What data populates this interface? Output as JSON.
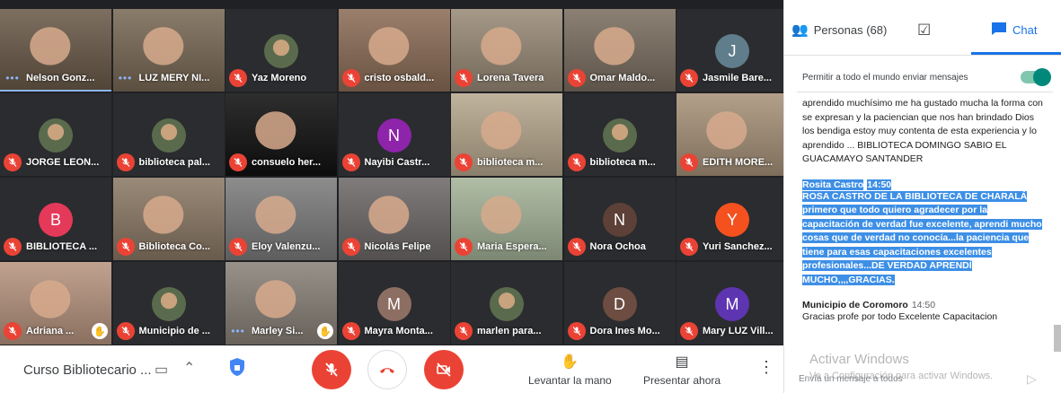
{
  "participants": [
    {
      "name": "Nelson Gonz...",
      "state": "talking",
      "kind": "video",
      "bg": "#6b5b4a"
    },
    {
      "name": "LUZ MERY NI...",
      "state": "talking",
      "kind": "video",
      "bg": "#7a6a56"
    },
    {
      "name": "Yaz Moreno",
      "state": "muted",
      "kind": "photo",
      "bg": "#2b2c2f"
    },
    {
      "name": "cristo osbald...",
      "state": "muted",
      "kind": "video",
      "bg": "#8d6e58"
    },
    {
      "name": "Lorena Tavera",
      "state": "muted",
      "kind": "video",
      "bg": "#9a8b78"
    },
    {
      "name": "Omar Maldo...",
      "state": "muted",
      "kind": "video",
      "bg": "#7c6f61"
    },
    {
      "name": "Jasmile Bare...",
      "state": "muted",
      "kind": "letter",
      "letter": "J",
      "color": "#607d8b",
      "bg": "#2b2c2f"
    },
    {
      "name": "JORGE LEON...",
      "state": "muted",
      "kind": "photo",
      "bg": "#2b2c2f"
    },
    {
      "name": "biblioteca pal...",
      "state": "muted",
      "kind": "photo",
      "bg": "#2b2c2f"
    },
    {
      "name": "consuelo her...",
      "state": "muted",
      "kind": "video",
      "bg": "#111111"
    },
    {
      "name": "Nayibi Castr...",
      "state": "muted",
      "kind": "letter",
      "letter": "N",
      "color": "#8e24aa",
      "bg": "#2b2c2f"
    },
    {
      "name": "biblioteca m...",
      "state": "muted",
      "kind": "video",
      "bg": "#b8a98f"
    },
    {
      "name": "biblioteca m...",
      "state": "muted",
      "kind": "photo",
      "bg": "#2b2c2f"
    },
    {
      "name": "EDITH MORE...",
      "state": "muted",
      "kind": "video",
      "bg": "#a8937a"
    },
    {
      "name": "BIBLIOTECA ...",
      "state": "muted",
      "kind": "letter",
      "letter": "B",
      "color": "#e53959",
      "bg": "#2b2c2f"
    },
    {
      "name": "Biblioteca Co...",
      "state": "muted",
      "kind": "video",
      "bg": "#8c7a66"
    },
    {
      "name": "Eloy Valenzu...",
      "state": "muted",
      "kind": "video",
      "bg": "#7d7d7d"
    },
    {
      "name": "Nicolás Felipe",
      "state": "muted",
      "kind": "video",
      "bg": "#6f6a6a"
    },
    {
      "name": "Maria Espera...",
      "state": "muted",
      "kind": "video",
      "bg": "#a6b59a"
    },
    {
      "name": "Nora Ochoa",
      "state": "muted",
      "kind": "letter",
      "letter": "N",
      "color": "#5d4037",
      "bg": "#2b2c2f"
    },
    {
      "name": "Yuri Sanchez...",
      "state": "muted",
      "kind": "letter",
      "letter": "Y",
      "color": "#f4511e",
      "bg": "#2b2c2f"
    },
    {
      "name": "Adriana ...",
      "state": "muted",
      "kind": "video",
      "bg": "#b89580",
      "hand": true
    },
    {
      "name": "Municipio de ...",
      "state": "muted",
      "kind": "photo",
      "bg": "#2b2c2f"
    },
    {
      "name": "Marley Si...",
      "state": "talking",
      "kind": "video",
      "bg": "#8a8279",
      "hand": true
    },
    {
      "name": "Mayra Monta...",
      "state": "muted",
      "kind": "letter",
      "letter": "M",
      "color": "#8d6e63",
      "bg": "#2b2c2f"
    },
    {
      "name": "marlen para...",
      "state": "muted",
      "kind": "photo",
      "bg": "#2b2c2f"
    },
    {
      "name": "Dora Ines Mo...",
      "state": "muted",
      "kind": "letter",
      "letter": "D",
      "color": "#6d4c41",
      "bg": "#2b2c2f"
    },
    {
      "name": "Mary LUZ Vill...",
      "state": "muted",
      "kind": "letter",
      "letter": "M",
      "color": "#5e35b1",
      "bg": "#2b2c2f"
    }
  ],
  "toolbar": {
    "meeting_title": "Curso Bibliotecario ...",
    "raise_hand_label": "Levantar la mano",
    "present_label": "Presentar ahora"
  },
  "panel": {
    "people_tab": "Personas (68)",
    "chat_tab": "Chat",
    "allow_messages_label": "Permitir a todo el mundo enviar mensajes",
    "allow_messages_on": true,
    "messages": [
      {
        "sender": "",
        "time": "",
        "text": "aprendido muchísimo me ha gustado mucha la forma con se expresan y la paciencian que nos han brindado Dios los bendiga estoy muy contenta de esta experiencia y lo aprendido ... BIBLIOTECA DOMINGO SABIO EL GUACAMAYO SANTANDER",
        "selected": false
      },
      {
        "sender": "Rosita Castro",
        "time": "14:50",
        "text": "ROSA CASTRO DE LA BIBLIOTECA DE CHARALÁ primero que todo quiero agradecer por la capacitación de verdad fue excelente, aprendi mucho cosas que de verdad no conocía...la paciencia que tiene para esas capacitaciones excelentes profesionales...DE VERDAD APRENDÍ MUCHO,,,,GRACIAS.",
        "selected": true
      },
      {
        "sender": "Municipio de Coromoro",
        "time": "14:50",
        "text": "Gracias profe por todo Excelente Capacitacion",
        "selected": false
      }
    ],
    "input_placeholder": "Envía un mensaje a todos",
    "watermark_title": "Activar Windows",
    "watermark_sub": "Ve a Configuración para activar Windows."
  },
  "colors": {
    "accent": "#1a73e8",
    "danger": "#ea4335",
    "toggle": "#00897b"
  }
}
